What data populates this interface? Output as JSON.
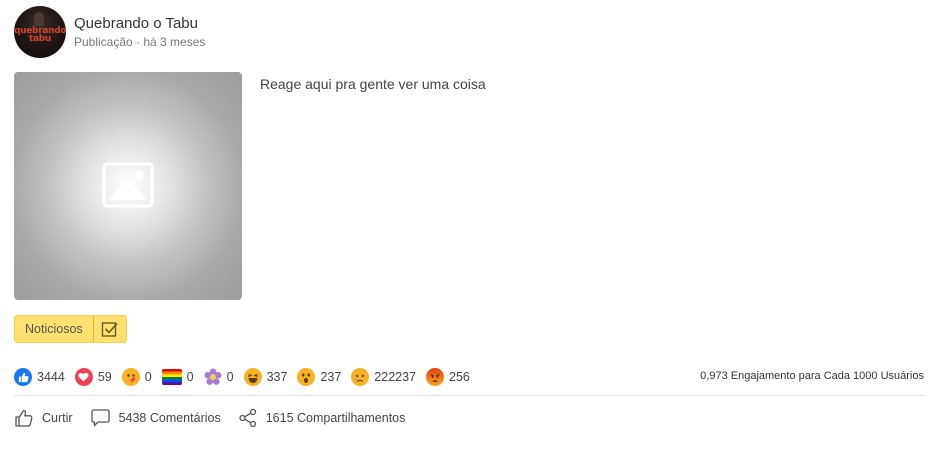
{
  "post": {
    "author": "Quebrando o Tabu",
    "avatar_text": "quebrando\ntabu",
    "meta": "Publicação · há 3 meses",
    "text": "Reage aqui pra gente ver uma coisa",
    "tag_label": "Noticiosos"
  },
  "reactions": [
    {
      "name": "like",
      "count": "3444",
      "color": "#1877f2"
    },
    {
      "name": "love",
      "count": "59",
      "color": "#f33e58"
    },
    {
      "name": "care",
      "count": "0",
      "color": "#f7b125"
    },
    {
      "name": "pride",
      "count": "0",
      "color": "#e24c3d"
    },
    {
      "name": "thankful",
      "count": "0",
      "color": "#a57ad8"
    },
    {
      "name": "haha",
      "count": "337",
      "color": "#f7b125"
    },
    {
      "name": "wow",
      "count": "237",
      "color": "#f7b125"
    },
    {
      "name": "sad",
      "count": "222237",
      "color": "#f7b125"
    },
    {
      "name": "angry",
      "count": "256",
      "color": "#e9710f"
    }
  ],
  "engagement": "0,973 Engajamento para Cada 1000 Usuários",
  "actions": {
    "like": "Curtir",
    "comments": "5438 Comentários",
    "shares": "1615 Compartilhamentos"
  }
}
